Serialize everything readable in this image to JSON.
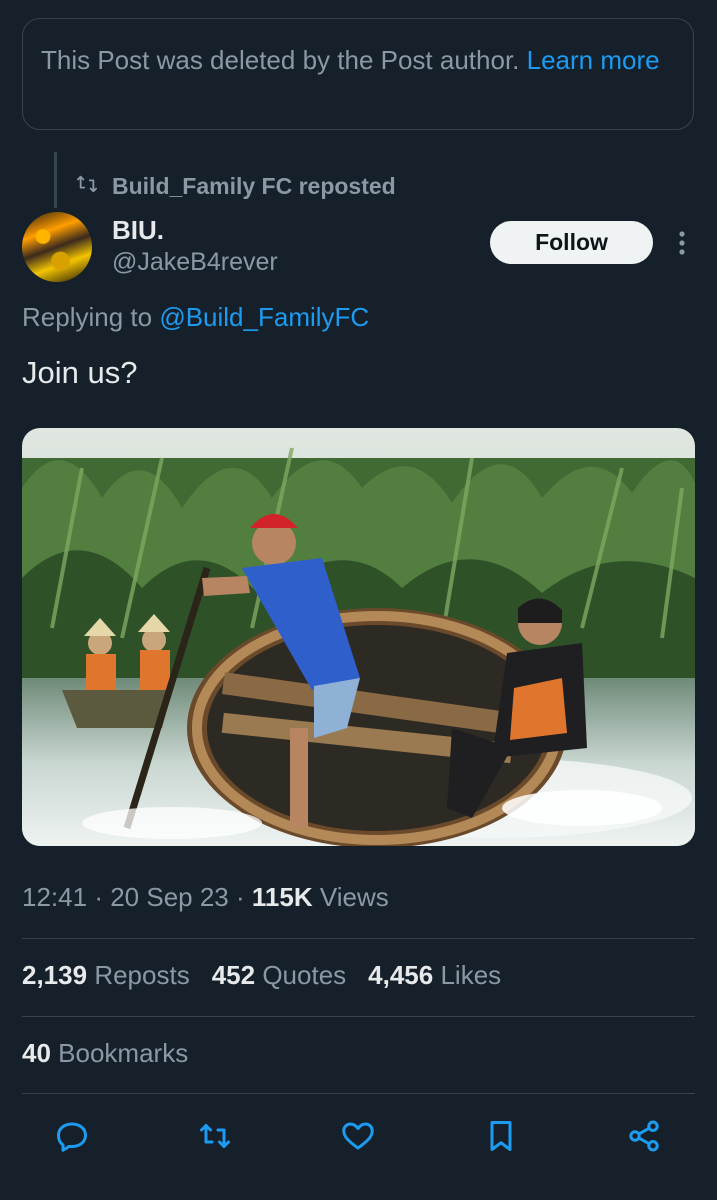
{
  "deleted_notice": {
    "text": "This Post was deleted by the Post author.",
    "link": "Learn more"
  },
  "repost": {
    "label": "Build_Family FC reposted",
    "icon": "repost-icon"
  },
  "author": {
    "display_name": "BIU.",
    "handle": "@JakeB4rever",
    "follow_label": "Follow"
  },
  "reply": {
    "prefix": "Replying to",
    "mention": "@Build_FamilyFC"
  },
  "tweet": {
    "text": "Join us?"
  },
  "meta": {
    "time": "12:41",
    "date": "20 Sep 23",
    "views_count": "115K",
    "views_label": "Views"
  },
  "stats": {
    "reposts_count": "2,139",
    "reposts_label": "Reposts",
    "quotes_count": "452",
    "quotes_label": "Quotes",
    "likes_count": "4,456",
    "likes_label": "Likes",
    "bookmarks_count": "40",
    "bookmarks_label": "Bookmarks"
  },
  "actions": [
    "reply-icon",
    "repost-icon",
    "like-icon",
    "bookmark-icon",
    "share-icon"
  ],
  "colors": {
    "background": "#15202b",
    "accent": "#1d9bf0",
    "secondary_text": "#8b98a5",
    "primary_text": "#e7e9ea",
    "border": "#38444d"
  }
}
